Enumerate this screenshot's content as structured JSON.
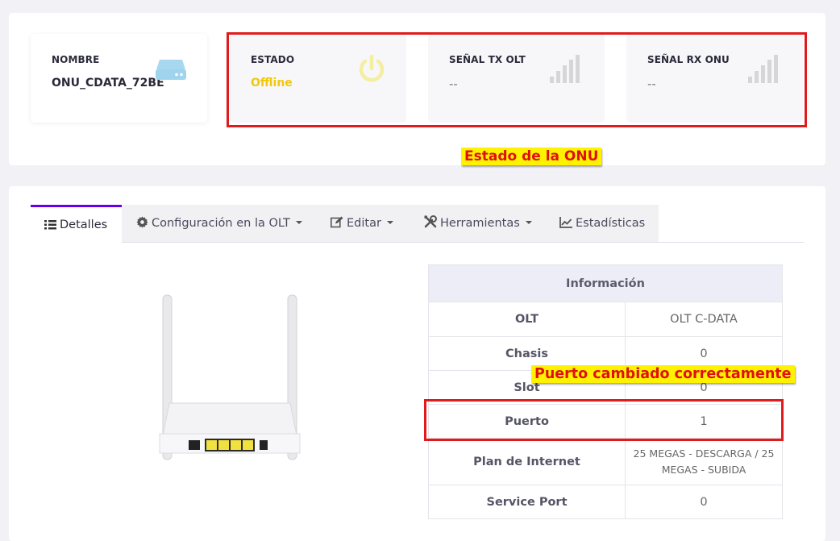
{
  "cards": {
    "nombre": {
      "label": "NOMBRE",
      "value": "ONU_CDATA_72BE",
      "icon": "hard-drive-icon"
    },
    "estado": {
      "label": "ESTADO",
      "value": "Offline",
      "icon": "power-icon"
    },
    "tx": {
      "label": "SEÑAL TX OLT",
      "value": "--",
      "icon": "signal-bars-icon"
    },
    "rx": {
      "label": "SEÑAL RX ONU",
      "value": "--",
      "icon": "signal-bars-icon"
    }
  },
  "annotations": {
    "estado_onu": "Estado de la ONU",
    "puerto_ok": "Puerto cambiado correctamente"
  },
  "tabs": [
    {
      "label": "Detalles",
      "icon": "list-icon"
    },
    {
      "label": "Configuración en la OLT",
      "icon": "gear-icon"
    },
    {
      "label": "Editar",
      "icon": "edit-icon"
    },
    {
      "label": "Herramientas",
      "icon": "tools-icon"
    },
    {
      "label": "Estadísticas",
      "icon": "chart-icon"
    }
  ],
  "info": {
    "header": "Información",
    "rows": [
      {
        "key": "OLT",
        "value": "OLT C-DATA"
      },
      {
        "key": "Chasis",
        "value": "0"
      },
      {
        "key": "Slot",
        "value": "0"
      },
      {
        "key": "Puerto",
        "value": "1"
      },
      {
        "key": "Plan de Internet",
        "value": "25 MEGAS - DESCARGA / 25 MEGAS - SUBIDA"
      },
      {
        "key": "Service Port",
        "value": "0"
      }
    ]
  },
  "colors": {
    "accent": "#6200ea",
    "offline": "#f3c70c",
    "annotation_red": "#e01b1b",
    "annotation_bg": "#fff200"
  }
}
